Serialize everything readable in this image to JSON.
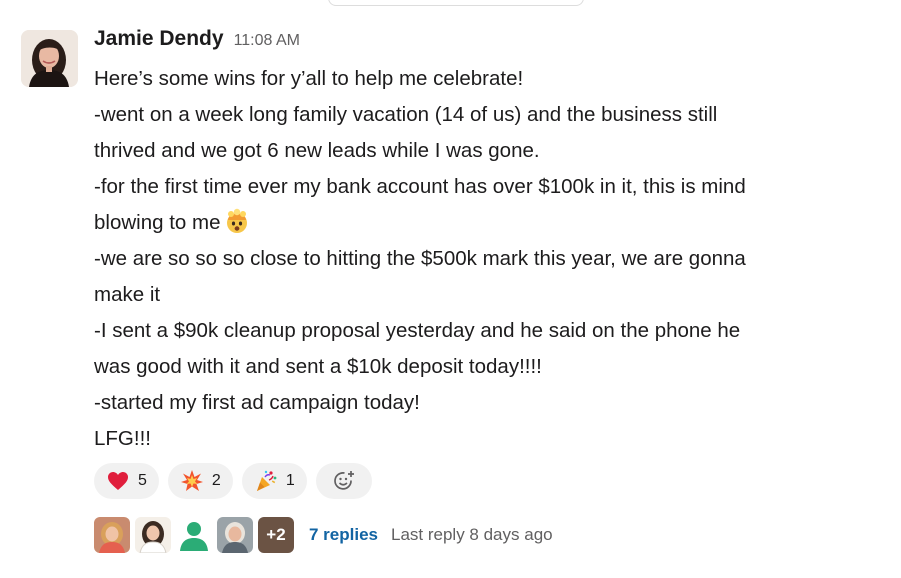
{
  "message": {
    "author": "Jamie Dendy",
    "timestamp": "11:08 AM",
    "avatar_icon": "profile-photo-icon",
    "lines": [
      "Here’s some wins for y’all to help me celebrate!",
      "-went on a week long family vacation (14 of us) and the business still",
      "thrived and we got 6 new leads while I was gone.",
      "-for the first time ever my bank account has over $100k in it, this is mind",
      "blowing to me",
      "-we are so so so close to hitting the $500k mark this year, we are gonna",
      "make it",
      "-I sent a $90k cleanup proposal yesterday and he said on the phone he",
      "was good with it and sent a $10k deposit today!!!!",
      "-started my first ad campaign today!",
      "LFG!!!"
    ],
    "inline_emoji": "exploding-head-icon"
  },
  "reactions": [
    {
      "icon": "heart-icon",
      "count": "5"
    },
    {
      "icon": "collision-icon",
      "count": "2"
    },
    {
      "icon": "party-popper-icon",
      "count": "1"
    }
  ],
  "add_reaction_icon": "add-reaction-icon",
  "thread": {
    "more_count": "+2",
    "replies_label": "7 replies",
    "last_reply": "Last reply 8 days ago"
  },
  "colors": {
    "link": "#1264a3",
    "reaction_bg": "#f1f1f1",
    "muted_text": "#616061",
    "heart": "#e01e3c"
  }
}
